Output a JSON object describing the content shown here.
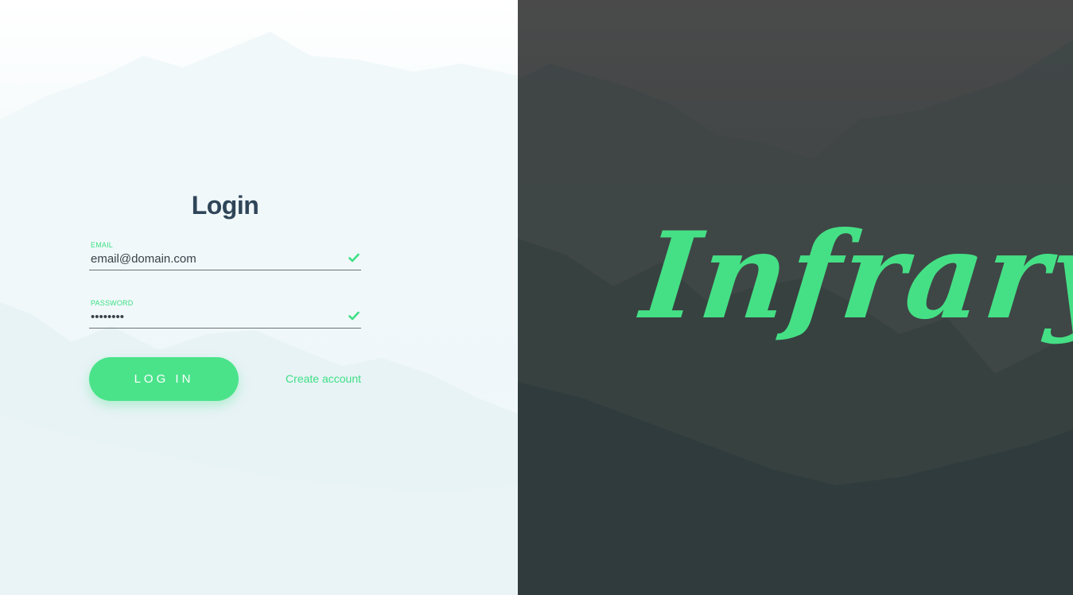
{
  "login": {
    "title": "Login",
    "email": {
      "label": "EMAIL",
      "value": "email@domain.com",
      "icon": "check-icon"
    },
    "password": {
      "label": "PASSWORD",
      "value": "••••••••",
      "icon": "check-icon"
    },
    "login_button": "LOG IN",
    "create_account": "Create account"
  },
  "brand": {
    "name": "Infrary"
  },
  "colors": {
    "accent": "#45e085",
    "title": "#2f4558",
    "right_panel": "#3a4548"
  }
}
